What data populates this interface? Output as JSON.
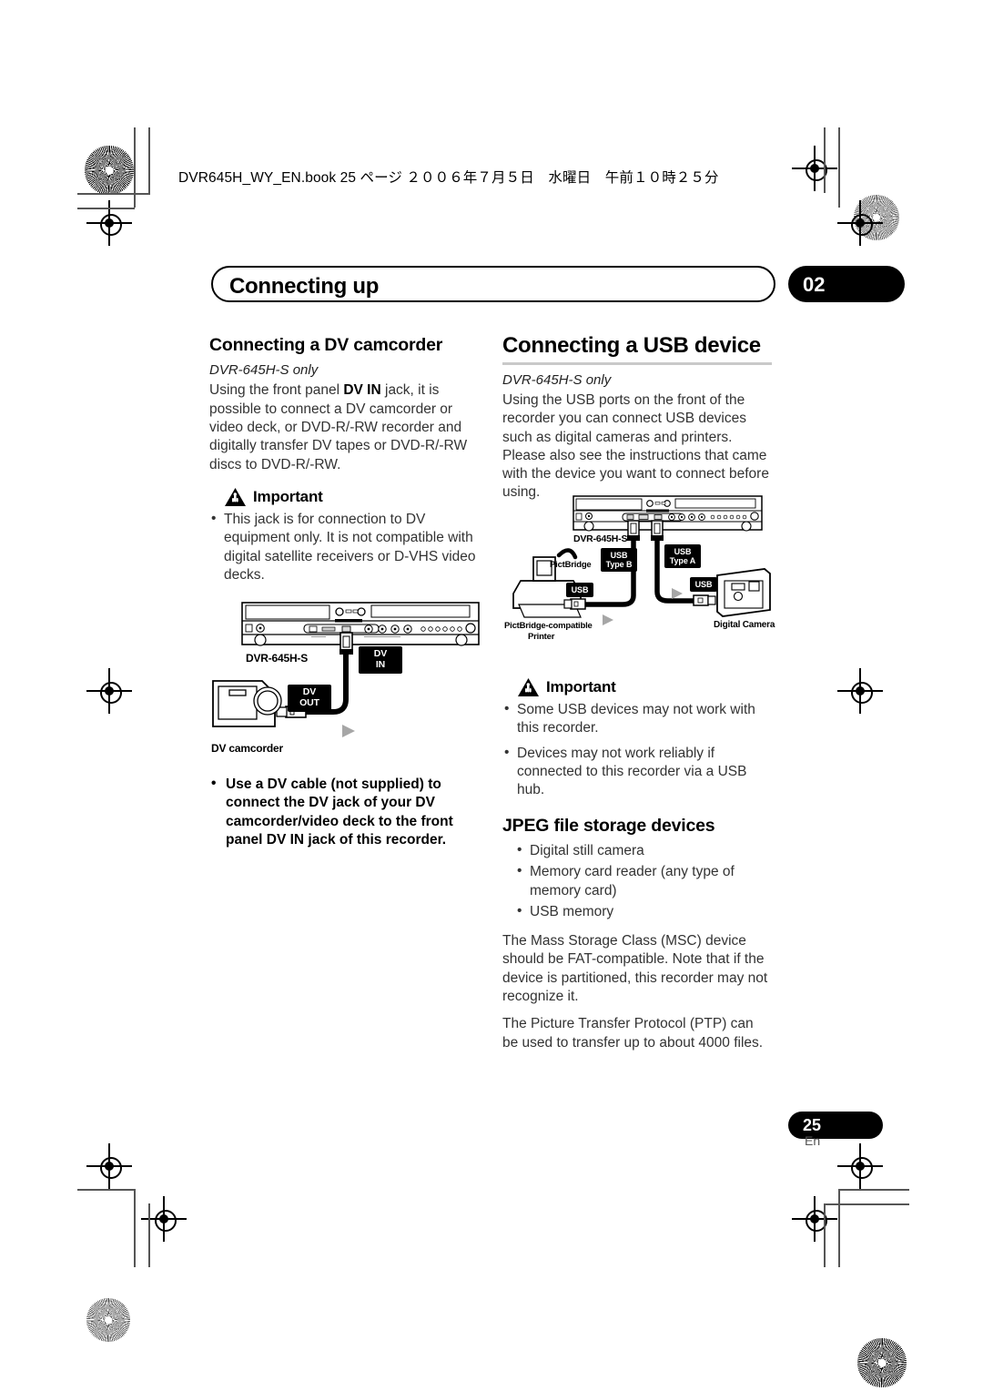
{
  "header": {
    "book_line": "DVR645H_WY_EN.book 25 ページ ２００６年７月５日　水曜日　午前１０時２５分"
  },
  "chapter": {
    "title": "Connecting up",
    "number": "02"
  },
  "left_column": {
    "heading": "Connecting a DV camcorder",
    "model_note": "DVR-645H-S only",
    "intro": "Using the front panel DV IN jack, it is possible to connect a DV camcorder or video deck, or DVD-R/-RW recorder and digitally transfer DV tapes or DVD-R/-RW discs to DVD-R/-RW.",
    "intro_bold_run": "DV IN",
    "important_label": "Important",
    "important_bullets": [
      "This jack is for connection to DV equipment only. It is not compatible with digital satellite receivers or D-VHS video decks."
    ],
    "bold_bullets": [
      "Use a DV cable (not supplied) to connect the DV jack of your DV camcorder/video deck to the front panel DV IN jack of this recorder."
    ],
    "diagram": {
      "recorder_label": "DVR-645H-S",
      "jack_in_label": "DV\nIN",
      "jack_in_line1": "DV",
      "jack_in_line2": "IN",
      "jack_out_line1": "DV",
      "jack_out_line2": "OUT",
      "device_label": "DV camcorder"
    }
  },
  "right_column": {
    "heading": "Connecting a USB device",
    "model_note": "DVR-645H-S only",
    "intro": "Using the USB ports on the front of the recorder you can connect USB devices such as digital cameras and printers. Please also see the instructions that came with the device you want to connect before using.",
    "important_label": "Important",
    "important_bullets": [
      "Some USB devices may not work with this recorder.",
      "Devices may not work reliably if connected to this recorder via a USB hub."
    ],
    "jpeg_heading": "JPEG file storage devices",
    "jpeg_bullets": [
      "Digital still camera",
      "Memory card reader (any type of memory card)",
      "USB memory"
    ],
    "paragraphs": [
      "The Mass Storage Class (MSC) device should be FAT-compatible. Note that if the device is partitioned, this recorder may not recognize it.",
      "The Picture Transfer Protocol (PTP) can be used to transfer up to about 4000 files."
    ],
    "diagram": {
      "recorder_label": "DVR-645H-S",
      "type_b_line1": "USB",
      "type_b_line2": "Type B",
      "type_a_line1": "USB",
      "type_a_line2": "Type A",
      "usb_tag_printer": "USB",
      "usb_tag_camera": "USB",
      "pictbridge_logo_label": "PictBridge",
      "printer_label_line1": "PictBridge-compatible",
      "printer_label_line2": "Printer",
      "camera_label": "Digital Camera"
    }
  },
  "footer": {
    "page_number": "25",
    "language": "En"
  },
  "colors": {
    "ink": "#000000",
    "body_text": "#333333",
    "rule": "#c9c9c9",
    "arrow_grey": "#a6a6a6"
  }
}
